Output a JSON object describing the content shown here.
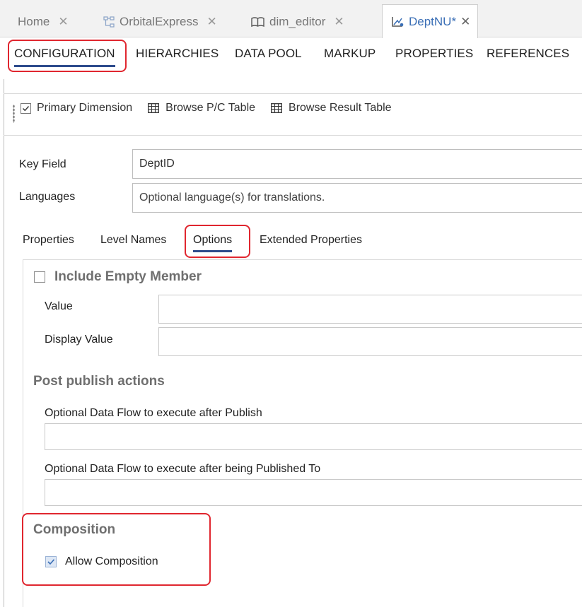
{
  "doc_tabs": [
    {
      "label": "Home",
      "icon": "home-icon"
    },
    {
      "label": "OrbitalExpress",
      "icon": "hierarchy-icon"
    },
    {
      "label": "dim_editor",
      "icon": "book-icon"
    },
    {
      "label": "DeptNU*",
      "icon": "dimension-icon",
      "active": true
    }
  ],
  "close_glyph": "✕",
  "sub_tabs": [
    "CONFIGURATION",
    "HIERARCHIES",
    "DATA POOL",
    "MARKUP",
    "PROPERTIES",
    "REFERENCES"
  ],
  "toolbar": {
    "primary_dimension": "Primary Dimension",
    "primary_dimension_checked": true,
    "browse_pc": "Browse P/C Table",
    "browse_result": "Browse Result Table"
  },
  "form": {
    "key_field_label": "Key Field",
    "key_field_value": "DeptID",
    "languages_label": "Languages",
    "languages_placeholder": "Optional language(s) for translations."
  },
  "form_tabs": [
    "Properties",
    "Level Names",
    "Options",
    "Extended Properties"
  ],
  "options": {
    "include_empty_member": "Include Empty Member",
    "value_label": "Value",
    "display_value_label": "Display Value",
    "post_publish_title": "Post publish actions",
    "after_publish_label": "Optional Data Flow to execute after Publish",
    "after_published_to_label": "Optional Data Flow to execute after being Published To",
    "composition_title": "Composition",
    "allow_composition": "Allow Composition",
    "allow_composition_checked": true
  },
  "colors": {
    "accent": "#3b6fb6",
    "highlight": "#e0262f",
    "underline": "#2d4b8c"
  }
}
